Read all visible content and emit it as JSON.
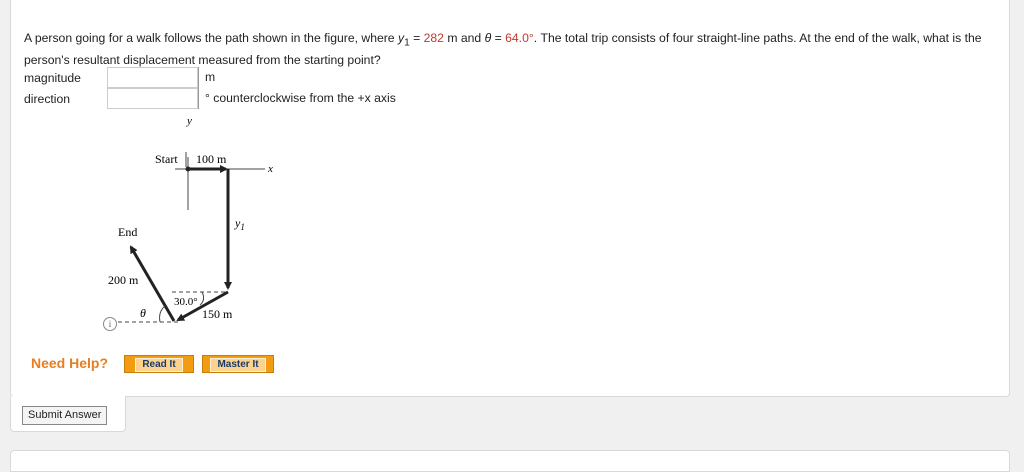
{
  "question": {
    "part1": "A person going for a walk follows the path shown in the figure, where ",
    "y1_symbol": "y",
    "y1_sub": "1",
    "eq": " = ",
    "y1_value": "282",
    "part2": " m and ",
    "theta_symbol": "θ",
    "eq2": " = ",
    "theta_value": "64.0°",
    "part3": ". The total trip consists of four straight-line paths. At the end of the walk, what is the person's resultant displacement measured from the starting point?"
  },
  "answers": {
    "magnitude_label": "magnitude",
    "magnitude_unit": "m",
    "direction_label": "direction",
    "direction_unit": "° counterclockwise from the +x axis"
  },
  "figure": {
    "y_axis": "y",
    "x_axis": "x",
    "start": "Start",
    "seg1": "100 m",
    "y1": "y",
    "y1_sub": "1",
    "end": "End",
    "seg4": "200 m",
    "angle30": "30.0°",
    "seg3": "150 m",
    "theta": "θ"
  },
  "info_icon": "i",
  "help": {
    "label": "Need Help?",
    "read": "Read It",
    "master": "Master It"
  },
  "submit": "Submit Answer",
  "colors": {
    "highlight": "#c0392b",
    "help": "#e67e22",
    "button": "#f39c12"
  }
}
